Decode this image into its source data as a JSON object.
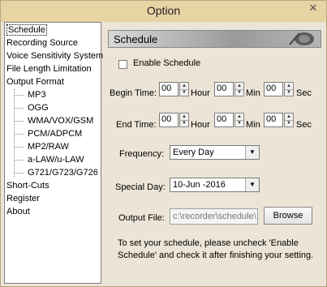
{
  "window": {
    "title": "Option",
    "close_glyph": "✕"
  },
  "tree": {
    "items": [
      {
        "label": "Schedule",
        "level": 0,
        "selected": true
      },
      {
        "label": "Recording Source",
        "level": 0
      },
      {
        "label": "Voice Sensitivity System",
        "level": 0
      },
      {
        "label": "File Length Limitation",
        "level": 0
      },
      {
        "label": "Output Format",
        "level": 0
      },
      {
        "label": "MP3",
        "level": 1
      },
      {
        "label": "OGG",
        "level": 1
      },
      {
        "label": "WMA/VOX/GSM",
        "level": 1
      },
      {
        "label": "PCM/ADPCM",
        "level": 1
      },
      {
        "label": "MP2/RAW",
        "level": 1
      },
      {
        "label": "a-LAW/u-LAW",
        "level": 1
      },
      {
        "label": "G721/G723/G726",
        "level": 1
      },
      {
        "label": "Short-Cuts",
        "level": 0
      },
      {
        "label": "Register",
        "level": 0
      },
      {
        "label": "About",
        "level": 0
      }
    ]
  },
  "panel": {
    "header": "Schedule",
    "enable_label": "Enable Schedule",
    "enable_checked": false,
    "begin": {
      "label": "Begin Time:",
      "hour": "00",
      "hour_unit": "Hour",
      "min": "00",
      "min_unit": "Min",
      "sec": "00",
      "sec_unit": "Sec"
    },
    "end": {
      "label": "End Time:",
      "hour": "00",
      "hour_unit": "Hour",
      "min": "00",
      "min_unit": "Min",
      "sec": "00",
      "sec_unit": "Sec"
    },
    "frequency": {
      "label": "Frequency:",
      "value": "Every Day"
    },
    "special_day": {
      "label": "Special Day:",
      "value": "10-Jun -2016"
    },
    "output": {
      "label": "Output File:",
      "value": "c:\\recorder\\schedule\\",
      "browse": "Browse"
    },
    "note_line1": "To set your schedule, please uncheck 'Enable",
    "note_line2": "Schedule' and check it after finishing your setting."
  }
}
